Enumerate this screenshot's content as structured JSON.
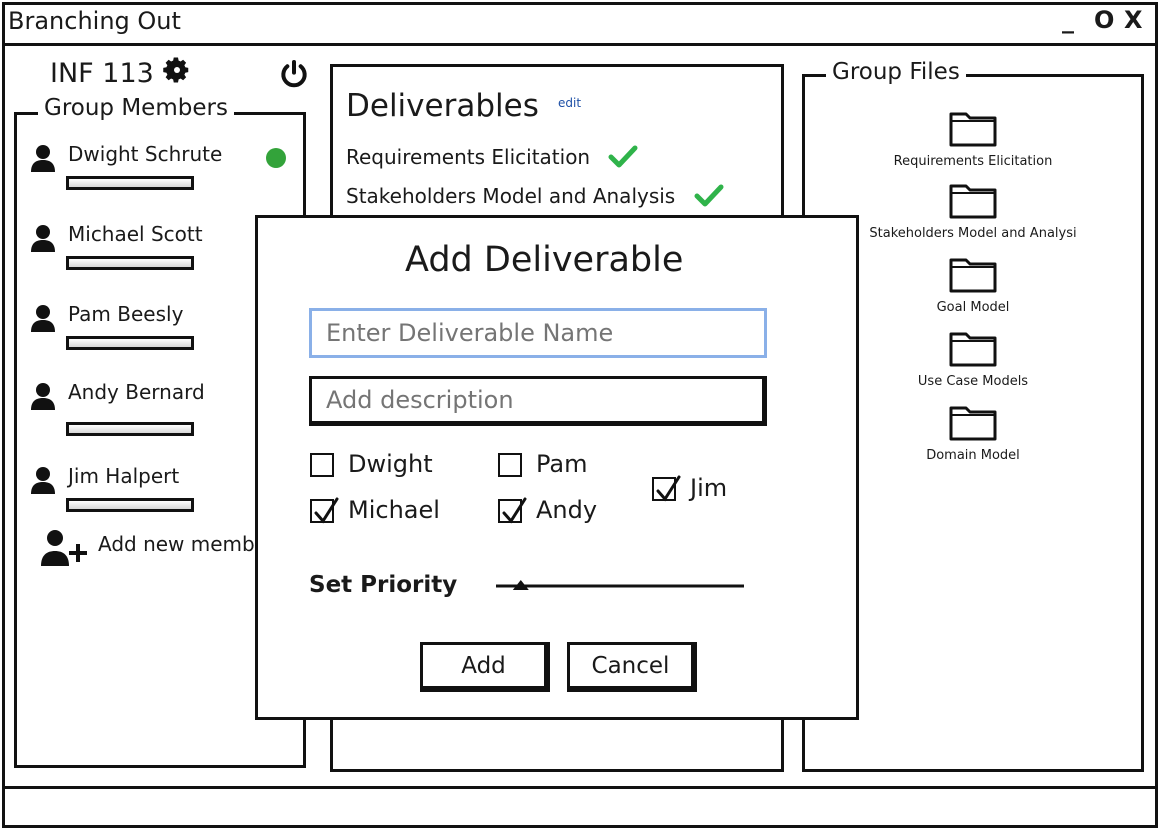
{
  "window": {
    "title": "Branching Out",
    "controls": [
      "_",
      "O",
      "X"
    ]
  },
  "course": {
    "title": "INF 113"
  },
  "members": {
    "legend": "Group Members",
    "items": [
      {
        "name": "Dwight Schrute",
        "online": true
      },
      {
        "name": "Michael Scott",
        "online": false
      },
      {
        "name": "Pam Beesly",
        "online": false
      },
      {
        "name": "Andy Bernard",
        "online": false
      },
      {
        "name": "Jim Halpert",
        "online": false
      }
    ],
    "add_label": "Add new member",
    "online_color": "#33a33a"
  },
  "deliverables": {
    "title": "Deliverables",
    "edit_label": "edit",
    "items": [
      {
        "label": "Requirements Elicitation",
        "done": true
      },
      {
        "label": "Stakeholders Model and Analysis",
        "done": true
      }
    ],
    "done_color": "#2fb34a"
  },
  "files": {
    "legend": "Group Files",
    "folders": [
      "Requirements Elicitation",
      "Stakeholders Model and Analysi",
      "Goal Model",
      "Use Case Models",
      "Domain Model"
    ]
  },
  "dialog": {
    "title": "Add Deliverable",
    "name_placeholder": "Enter Deliverable Name",
    "desc_placeholder": "Add description",
    "assignees": [
      {
        "name": "Dwight",
        "checked": false
      },
      {
        "name": "Pam",
        "checked": false
      },
      {
        "name": "Jim",
        "checked": true
      },
      {
        "name": "Michael",
        "checked": true
      },
      {
        "name": "Andy",
        "checked": true
      }
    ],
    "priority_label": "Set Priority",
    "priority_value": 0.1,
    "add_label": "Add",
    "cancel_label": "Cancel",
    "focus_color": "#8ab0e8"
  }
}
